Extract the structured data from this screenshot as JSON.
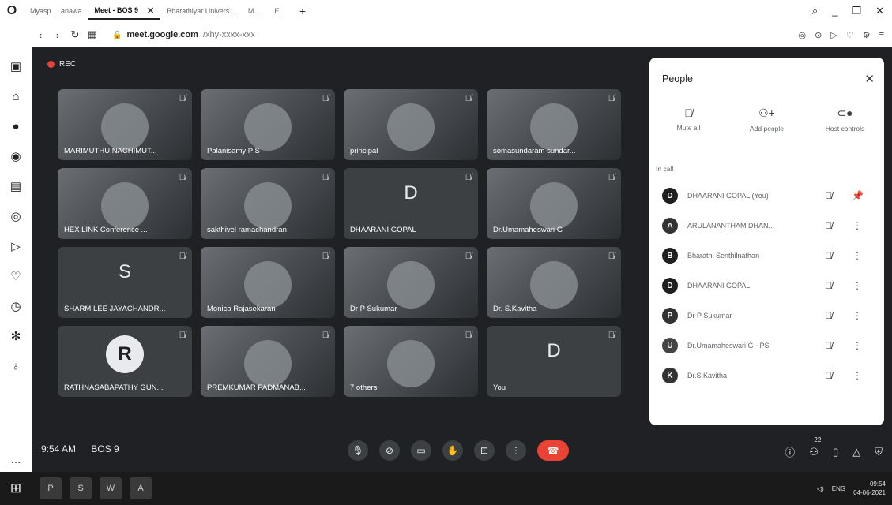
{
  "browser": {
    "tabs": [
      {
        "label": "Myasp ... anawa"
      },
      {
        "label": "Meet - BOS 9",
        "active": true
      },
      {
        "label": "Bharathiyar Univers..."
      },
      {
        "label": "M ..."
      },
      {
        "label": "E..."
      }
    ],
    "url_domain": "meet.google.com",
    "url_path": "/xhy-xxxx-xxx"
  },
  "meet": {
    "rec_label": "REC",
    "time": "9:54 AM",
    "meeting_code": "BOS 9",
    "people_count": "22",
    "tiles": [
      {
        "name": "MARIMUTHU NACHIMUT...",
        "kind": "video"
      },
      {
        "name": "Palanisamy P S",
        "kind": "video"
      },
      {
        "name": "principal",
        "kind": "video"
      },
      {
        "name": "somasundaram sundar...",
        "kind": "video"
      },
      {
        "name": "HEX LINK Conference ...",
        "kind": "video"
      },
      {
        "name": "sakthivel ramachandran",
        "kind": "video"
      },
      {
        "name": "DHAARANI GOPAL",
        "kind": "letter",
        "letter": "D"
      },
      {
        "name": "Dr.Umamaheswari G",
        "kind": "video"
      },
      {
        "name": "SHARMILEE JAYACHANDR...",
        "kind": "letter",
        "letter": "S"
      },
      {
        "name": "Monica Rajasekaran",
        "kind": "video"
      },
      {
        "name": "Dr P Sukumar",
        "kind": "video"
      },
      {
        "name": "Dr. S.Kavitha",
        "kind": "video"
      },
      {
        "name": "RATHNASABAPATHY GUN...",
        "kind": "avatar",
        "letter": "R"
      },
      {
        "name": "PREMKUMAR PADMANAB...",
        "kind": "video"
      },
      {
        "name": "7 others",
        "kind": "video"
      },
      {
        "name": "You",
        "kind": "letter",
        "letter": "D"
      }
    ]
  },
  "people_panel": {
    "title": "People",
    "actions": [
      {
        "label": "Mute all"
      },
      {
        "label": "Add people"
      },
      {
        "label": "Host controls"
      }
    ],
    "section_label": "In call",
    "participants": [
      {
        "name": "DHAARANI GOPAL (You)",
        "initial": "D",
        "color": "#1f1f1f"
      },
      {
        "name": "ARULANANTHAM DHAN...",
        "initial": "A",
        "color": "#333333"
      },
      {
        "name": "Bharathi Senthilnathan",
        "initial": "B",
        "color": "#1f1f1f"
      },
      {
        "name": "DHAARANI GOPAL",
        "initial": "D",
        "color": "#1f1f1f"
      },
      {
        "name": "Dr P Sukumar",
        "initial": "P",
        "color": "#333333"
      },
      {
        "name": "Dr.Umamaheswari G - PS",
        "initial": "U",
        "color": "#444444"
      },
      {
        "name": "Dr.S.Kavitha",
        "initial": "K",
        "color": "#333333"
      }
    ]
  },
  "taskbar": {
    "apps": [
      "P",
      "S",
      "W",
      "A"
    ],
    "time": "09:54",
    "date": "04-06-2021"
  },
  "colors": {
    "meet_bg": "#202124",
    "tile_bg": "#3c4043",
    "end_call": "#ea4335",
    "taskbar_bg": "#1a1a1a"
  }
}
